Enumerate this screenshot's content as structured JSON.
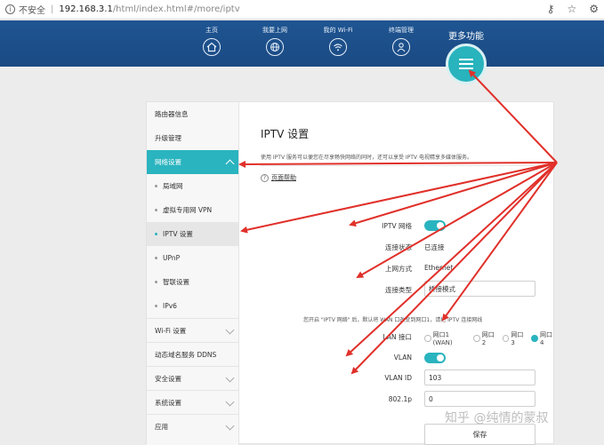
{
  "browser": {
    "warning_icon": "info-icon",
    "insecure_label": "不安全",
    "url_host": "192.168.3.1",
    "url_path": "/html/index.html#/more/iptv",
    "tools": [
      "key-icon",
      "star-icon",
      "settings-icon"
    ]
  },
  "nav": {
    "items": [
      {
        "label": "主页",
        "icon": "home-icon"
      },
      {
        "label": "我要上网",
        "icon": "globe-icon"
      },
      {
        "label": "我的 Wi-Fi",
        "icon": "wifi-icon"
      },
      {
        "label": "终端管理",
        "icon": "user-icon"
      }
    ],
    "more_label": "更多功能",
    "more_icon": "menu-icon"
  },
  "sidebar": {
    "items": [
      {
        "label": "路由器信息"
      },
      {
        "label": "升级管理"
      },
      {
        "label": "网络设置"
      },
      {
        "label": "局域网"
      },
      {
        "label": "虚拟专用网 VPN"
      },
      {
        "label": "IPTV 设置"
      },
      {
        "label": "UPnP"
      },
      {
        "label": "智联设置"
      },
      {
        "label": "IPv6"
      },
      {
        "label": "Wi-Fi 设置"
      },
      {
        "label": "动态域名服务 DDNS"
      },
      {
        "label": "安全设置"
      },
      {
        "label": "系统设置"
      },
      {
        "label": "应用"
      }
    ]
  },
  "main": {
    "title": "IPTV 设置",
    "description": "使用 IPTV 服务可以便您在尽享畅快网络的同时，还可以享受 IPTV 电视精享多媒体服务。",
    "help_label": "页面帮助",
    "iptv_label": "IPTV 网络",
    "status_label": "连接状态",
    "status_value": "已连接",
    "uplink_label": "上网方式",
    "uplink_value": "Ethernet",
    "conn_type_label": "连接类型",
    "conn_type_value": "桥接模式",
    "note": "您开启 \"IPTV 网络\" 后，默认将 WAN 口改变到网口1，请把 IPTV 连接网线",
    "lan_label": "LAN 接口",
    "lan_options": [
      {
        "label": "网口1 (WAN)",
        "checked": false
      },
      {
        "label": "网口2",
        "checked": false
      },
      {
        "label": "网口3",
        "checked": false
      },
      {
        "label": "网口4",
        "checked": true
      }
    ],
    "vlan_label": "VLAN",
    "vlan_id_label": "VLAN ID",
    "vlan_id_value": "103",
    "dot1p_label": "802.1p",
    "dot1p_value": "0",
    "save_label": "保存"
  },
  "watermark": "知乎 @纯情的蒙叔",
  "colors": {
    "accent": "#2ab4bf",
    "header": "#1d4f8a",
    "arrow": "#e0302a"
  }
}
